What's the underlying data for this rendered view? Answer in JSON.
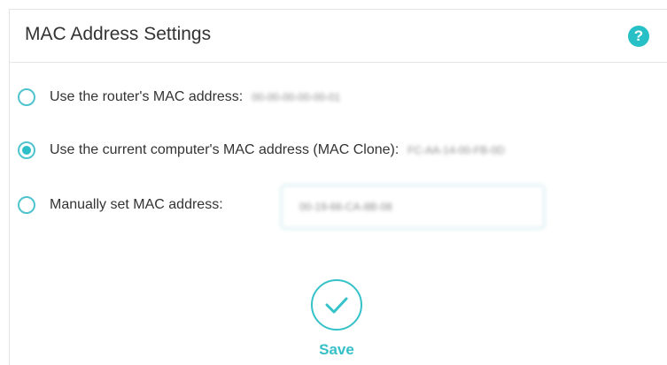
{
  "panel": {
    "title": "MAC Address Settings",
    "help_icon": "question-circle-icon",
    "help_glyph": "?"
  },
  "options": [
    {
      "label": "Use the router's MAC address:",
      "value": "00-00-00-00-00-01",
      "selected": false
    },
    {
      "label": "Use the current computer's MAC address (MAC Clone):",
      "value": "FC-AA-14-00-FB-0D",
      "selected": true
    },
    {
      "label": "Manually set MAC address:",
      "value": "00-19-66-CA-8B-08",
      "selected": false
    }
  ],
  "save": {
    "label": "Save",
    "icon": "checkmark-circle-icon"
  },
  "colors": {
    "accent": "#2cbfc8",
    "text": "#333333",
    "border": "#e3e3e3"
  }
}
